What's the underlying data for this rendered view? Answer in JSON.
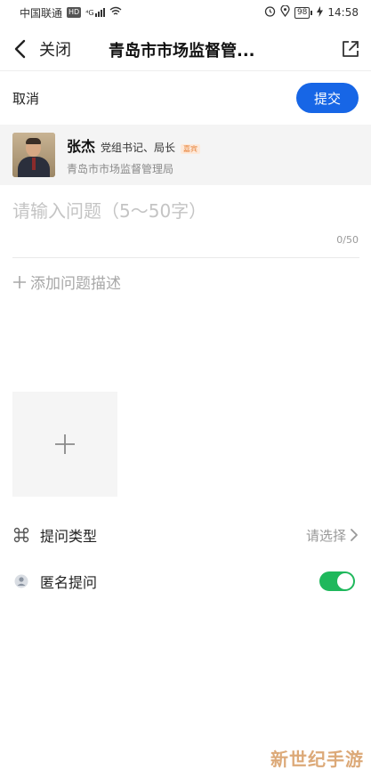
{
  "status_bar": {
    "carrier": "中国联通",
    "hd_badge": "HD",
    "signal_label": "⁴G",
    "battery": "98",
    "time": "14:58"
  },
  "nav": {
    "close_label": "关闭",
    "title": "青岛市市场监督管..."
  },
  "actions": {
    "cancel_label": "取消",
    "submit_label": "提交"
  },
  "target": {
    "name": "张杰",
    "position": "党组书记、局长",
    "tag": "嘉宾",
    "organization": "青岛市市场监督管理局"
  },
  "question": {
    "placeholder": "请输入问题（5～50字）",
    "value": "",
    "counter": "0/50"
  },
  "description": {
    "add_label": "添加问题描述"
  },
  "settings": {
    "type_label": "提问类型",
    "type_value": "请选择",
    "anonymous_label": "匿名提问",
    "anonymous_enabled": true
  },
  "colors": {
    "primary": "#1766e6",
    "toggle_on": "#1fb85c"
  },
  "watermark": "新世纪手游"
}
